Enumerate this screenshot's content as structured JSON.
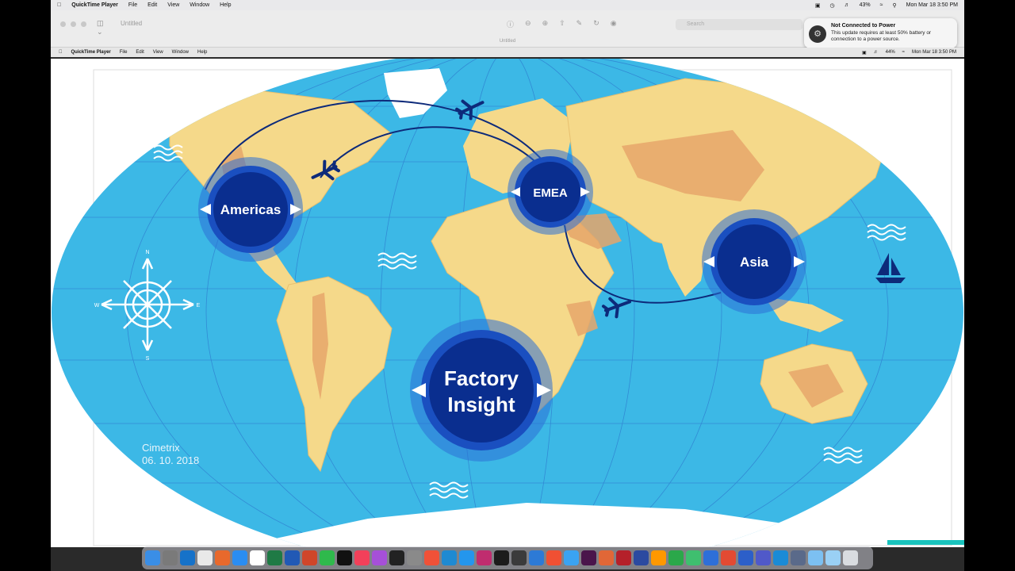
{
  "menubar": {
    "app": "QuickTime Player",
    "items": [
      "File",
      "Edit",
      "View",
      "Window",
      "Help"
    ],
    "battery": "43%",
    "datetime": "Mon Mar 18  3:50 PM"
  },
  "player": {
    "title": "Untitled",
    "subtitle": "Untitled",
    "search_placeholder": "Search"
  },
  "notification": {
    "title": "Not Connected to Power",
    "body": "This update requires at least 50% battery or connection to a power source."
  },
  "inner_menubar": {
    "app": "QuickTime Player",
    "items": [
      "File",
      "Edit",
      "View",
      "Window",
      "Help"
    ],
    "battery": "44%",
    "datetime": "Mon Mar 18  3:50 PM"
  },
  "slide": {
    "hubs": {
      "americas": "Americas",
      "emea": "EMEA",
      "asia": "Asia",
      "factory_line1": "Factory",
      "factory_line2": "Insight"
    },
    "credit_name": "Cimetrix",
    "credit_date": "06. 10. 2018",
    "compass": {
      "n": "N",
      "s": "S",
      "e": "E",
      "w": "W"
    }
  },
  "colors": {
    "ocean": "#3cb8e6",
    "land": "#f5d98a",
    "terrain": "#e6a66a",
    "hub_dark": "#0a2e8f",
    "hub_ring": "#2b6fd6",
    "route": "#0d2a7a"
  }
}
